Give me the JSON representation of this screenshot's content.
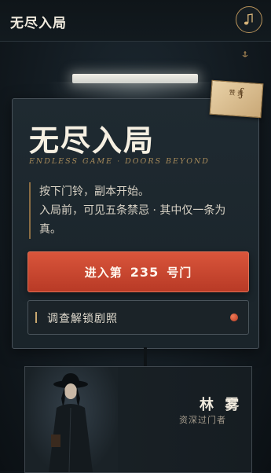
{
  "header": {
    "title": "无尽入局",
    "music_icon": "music-note-icon"
  },
  "note": {
    "text": "赞 贵"
  },
  "card": {
    "title": "无尽入局",
    "subtitle": "ENDLESS GAME · DOORS BEYOND",
    "description": [
      "按下门铃，副本开始。",
      "入局前，可见五条禁忌 · 其中仅一条为",
      "真。"
    ],
    "cta": {
      "prefix": "进入第",
      "number": "235",
      "suffix": "号门"
    },
    "secondary_label": "调查解锁剧照"
  },
  "character": {
    "name": "林 雾",
    "role": "资深过门者"
  },
  "colors": {
    "accent_red": "#c8452f",
    "gold": "#b9935a",
    "background": "#131b21"
  }
}
